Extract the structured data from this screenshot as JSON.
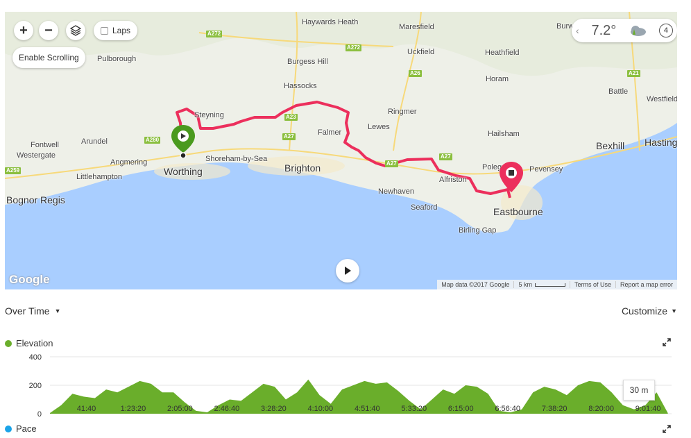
{
  "map": {
    "zoom_in": "+",
    "zoom_out": "−",
    "laps_label": "Laps",
    "enable_scrolling": "Enable Scrolling",
    "weather_temp": "7.2°",
    "weather_wind": "4",
    "google_logo": "Google",
    "attribution": [
      "Map data ©2017 Google",
      "5 km",
      "Terms of Use",
      "Report a map error"
    ],
    "places": [
      {
        "name": "Haywards Heath",
        "big": false
      },
      {
        "name": "Maresfield",
        "big": false
      },
      {
        "name": "Burgess Hill",
        "big": false
      },
      {
        "name": "Uckfield",
        "big": false
      },
      {
        "name": "Heathfield",
        "big": false
      },
      {
        "name": "Pulborough",
        "big": false
      },
      {
        "name": "Hassocks",
        "big": false
      },
      {
        "name": "Horam",
        "big": false
      },
      {
        "name": "Battle",
        "big": false
      },
      {
        "name": "Westfield",
        "big": false
      },
      {
        "name": "Steyning",
        "big": false
      },
      {
        "name": "Ringmer",
        "big": false
      },
      {
        "name": "Lewes",
        "big": false
      },
      {
        "name": "Falmer",
        "big": false
      },
      {
        "name": "Hailsham",
        "big": false
      },
      {
        "name": "Bexhill",
        "big": true
      },
      {
        "name": "Hasting",
        "big": true
      },
      {
        "name": "Fontwell",
        "big": false
      },
      {
        "name": "Westergate",
        "big": false
      },
      {
        "name": "Arundel",
        "big": false
      },
      {
        "name": "Angmering",
        "big": false
      },
      {
        "name": "Shoreham-by-Sea",
        "big": false
      },
      {
        "name": "Brighton",
        "big": true
      },
      {
        "name": "Worthing",
        "big": true
      },
      {
        "name": "Littlehampton",
        "big": false
      },
      {
        "name": "Bognor Regis",
        "big": true
      },
      {
        "name": "Newhaven",
        "big": false
      },
      {
        "name": "Seaford",
        "big": false
      },
      {
        "name": "Alfriston",
        "big": false
      },
      {
        "name": "Polegate",
        "big": false
      },
      {
        "name": "Pevensey",
        "big": false
      },
      {
        "name": "Eastbourne",
        "big": true
      },
      {
        "name": "Birling Gap",
        "big": false
      },
      {
        "name": "Burw",
        "big": false
      }
    ],
    "roads": [
      "A272",
      "A272",
      "A26",
      "A21",
      "A23",
      "A27",
      "A280",
      "A259",
      "A27",
      "A27"
    ]
  },
  "controls": {
    "over_time": "Over Time",
    "customize": "Customize"
  },
  "charts": {
    "elevation_label": "Elevation",
    "pace_label": "Pace",
    "tooltip": "30 m",
    "elevation_color": "#6aae2b",
    "pace_color": "#1aa3e8"
  },
  "chart_data": {
    "type": "area",
    "title": "Elevation",
    "xlabel": "",
    "ylabel": "",
    "ylim": [
      0,
      400
    ],
    "yticks": [
      0,
      200,
      400
    ],
    "xticks": [
      "41:40",
      "1:23:20",
      "2:05:00",
      "2:46:40",
      "3:28:20",
      "4:10:00",
      "4:51:40",
      "5:33:20",
      "6:15:00",
      "6:56:40",
      "7:38:20",
      "8:20:00",
      "9:01:40"
    ],
    "x_range_seconds": [
      0,
      33200
    ],
    "series": [
      {
        "name": "Elevation",
        "x_seconds": [
          0,
          600,
          1200,
          1800,
          2400,
          3000,
          3600,
          4200,
          4800,
          5400,
          6000,
          6600,
          7200,
          7800,
          8400,
          9000,
          9600,
          10200,
          10800,
          11400,
          12000,
          12600,
          13200,
          13800,
          14400,
          15000,
          15600,
          16200,
          16800,
          17400,
          18000,
          18600,
          19200,
          19800,
          20400,
          21000,
          21600,
          22200,
          22800,
          23400,
          24000,
          24600,
          25200,
          25800,
          26400,
          27000,
          27600,
          28200,
          28800,
          29400,
          30000,
          30600,
          31200,
          31800,
          32400,
          33000
        ],
        "values": [
          5,
          60,
          140,
          120,
          110,
          170,
          150,
          190,
          230,
          210,
          150,
          150,
          80,
          20,
          10,
          60,
          100,
          90,
          150,
          210,
          190,
          100,
          150,
          240,
          130,
          70,
          170,
          200,
          230,
          210,
          220,
          160,
          90,
          30,
          100,
          170,
          140,
          200,
          190,
          140,
          20,
          10,
          30,
          150,
          190,
          170,
          130,
          200,
          230,
          220,
          150,
          60,
          30,
          60,
          150,
          5
        ]
      }
    ]
  }
}
